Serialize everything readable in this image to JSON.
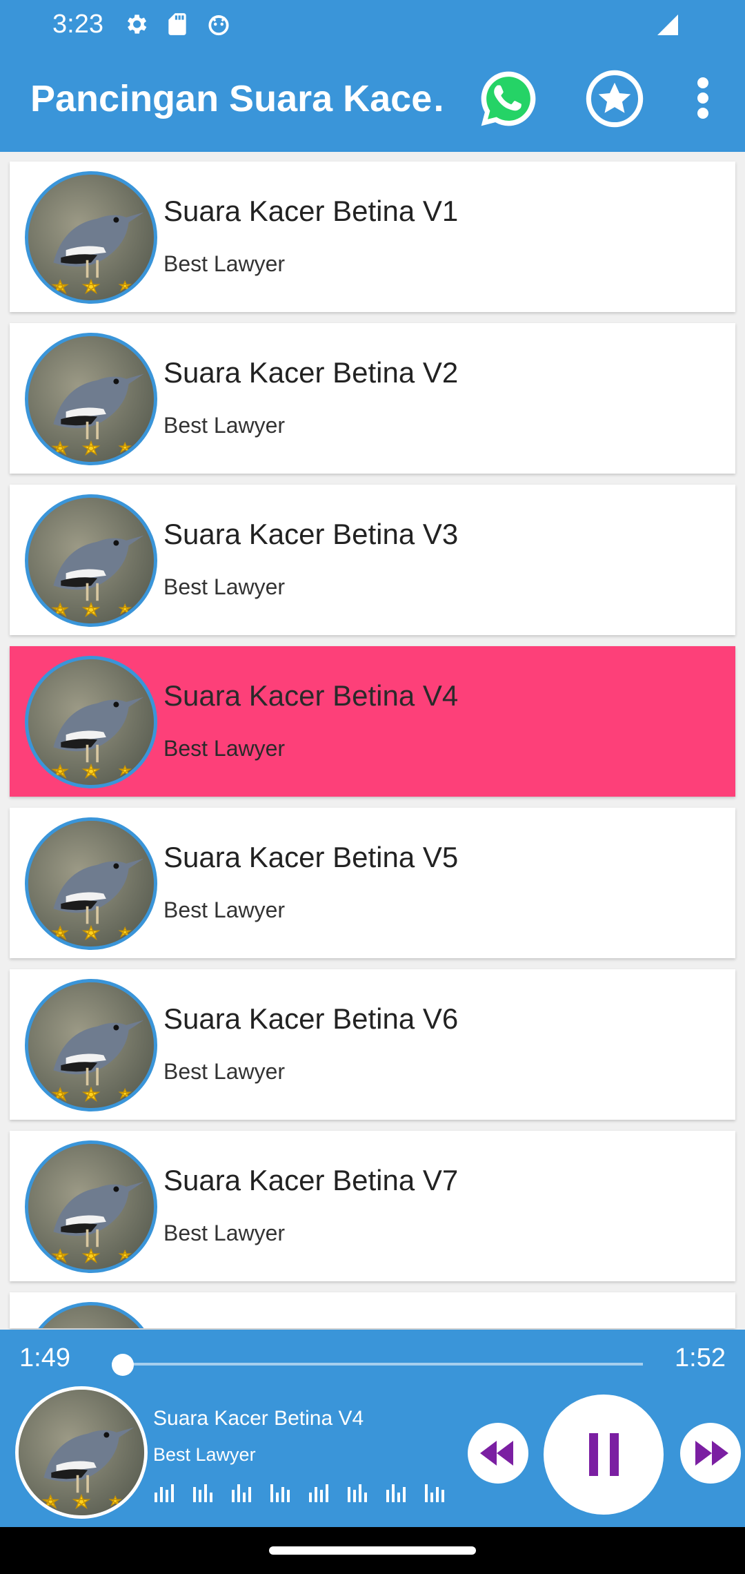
{
  "status_bar": {
    "time": "3:23",
    "icons": [
      "settings-icon",
      "sd-card-icon",
      "face-icon"
    ],
    "signal_icon": "cell-signal-icon"
  },
  "app_bar": {
    "title": "Pancingan Suara Kace…",
    "actions": [
      "whatsapp-icon",
      "star-icon",
      "more-vert-icon"
    ],
    "color": "#3a95d9"
  },
  "list": {
    "items": [
      {
        "title": "Suara Kacer Betina V1",
        "subtitle": "Best Lawyer",
        "active": false
      },
      {
        "title": "Suara Kacer Betina V2",
        "subtitle": "Best Lawyer",
        "active": false
      },
      {
        "title": "Suara Kacer Betina V3",
        "subtitle": "Best Lawyer",
        "active": false
      },
      {
        "title": "Suara Kacer Betina V4",
        "subtitle": "Best Lawyer",
        "active": true
      },
      {
        "title": "Suara Kacer Betina V5",
        "subtitle": "Best Lawyer",
        "active": false
      },
      {
        "title": "Suara Kacer Betina V6",
        "subtitle": "Best Lawyer",
        "active": false
      },
      {
        "title": "Suara Kacer Betina V7",
        "subtitle": "Best Lawyer",
        "active": false
      }
    ],
    "active_color": "#fd4079"
  },
  "player": {
    "current_time": "1:49",
    "total_time": "1:52",
    "progress": 0.0,
    "title": "Suara Kacer Betina V4",
    "subtitle": "Best Lawyer",
    "state": "playing",
    "controls": [
      "rewind-icon",
      "pause-icon",
      "fast-forward-icon"
    ],
    "accent": "#7b1fa2"
  }
}
